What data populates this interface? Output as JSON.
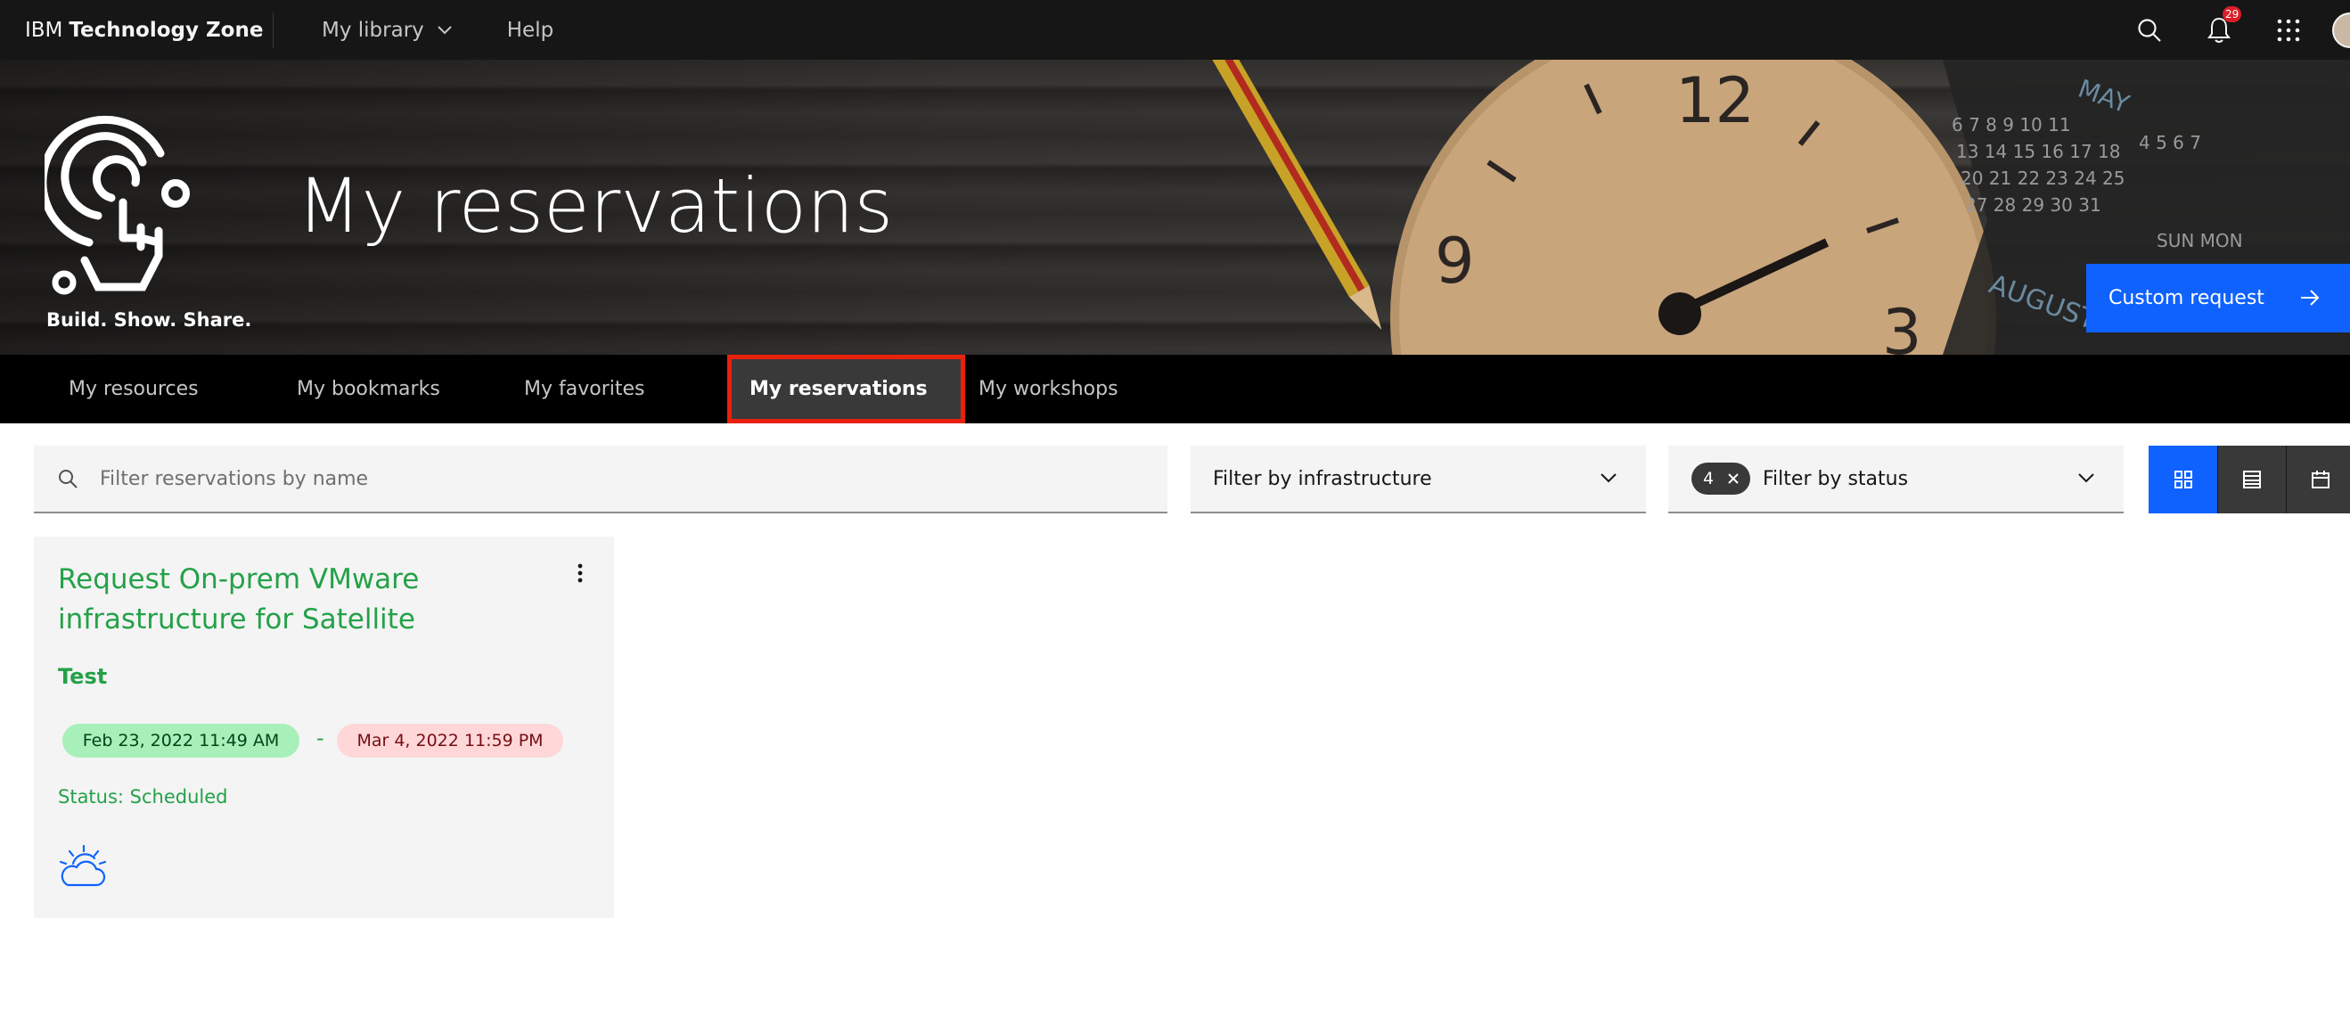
{
  "app": {
    "brand_prefix": "IBM",
    "brand_name": "Technology Zone"
  },
  "topnav": {
    "library": "My library",
    "help": "Help",
    "notifications_count": "29",
    "icons": [
      "search-icon",
      "notification-icon",
      "app-switcher-icon",
      "user-avatar"
    ]
  },
  "hero": {
    "tagline": "Build. Show. Share.",
    "title": "My reservations",
    "custom_request": "Custom request"
  },
  "tabs": [
    {
      "label": "My resources",
      "active": false
    },
    {
      "label": "My bookmarks",
      "active": false
    },
    {
      "label": "My favorites",
      "active": false
    },
    {
      "label": "My reservations",
      "active": true
    },
    {
      "label": "My workshops",
      "active": false
    }
  ],
  "filters": {
    "search_placeholder": "Filter reservations by name",
    "infrastructure": "Filter by infrastructure",
    "status_count": "4",
    "status": "Filter by status",
    "views": [
      "grid-view-icon",
      "list-view-icon",
      "calendar-view-icon"
    ],
    "active_view": "grid"
  },
  "reservations": [
    {
      "title": "Request On-prem VMware infrastructure for Satellite",
      "name": "Test",
      "start": "Feb 23, 2022 11:49 AM",
      "separator": "-",
      "end": "Mar 4, 2022 11:59 PM",
      "status": "Status: Scheduled",
      "icon": "cloud-icon"
    }
  ],
  "colors": {
    "accent": "#0f62fe",
    "success": "#24a148",
    "highlight": "#e8210d"
  }
}
